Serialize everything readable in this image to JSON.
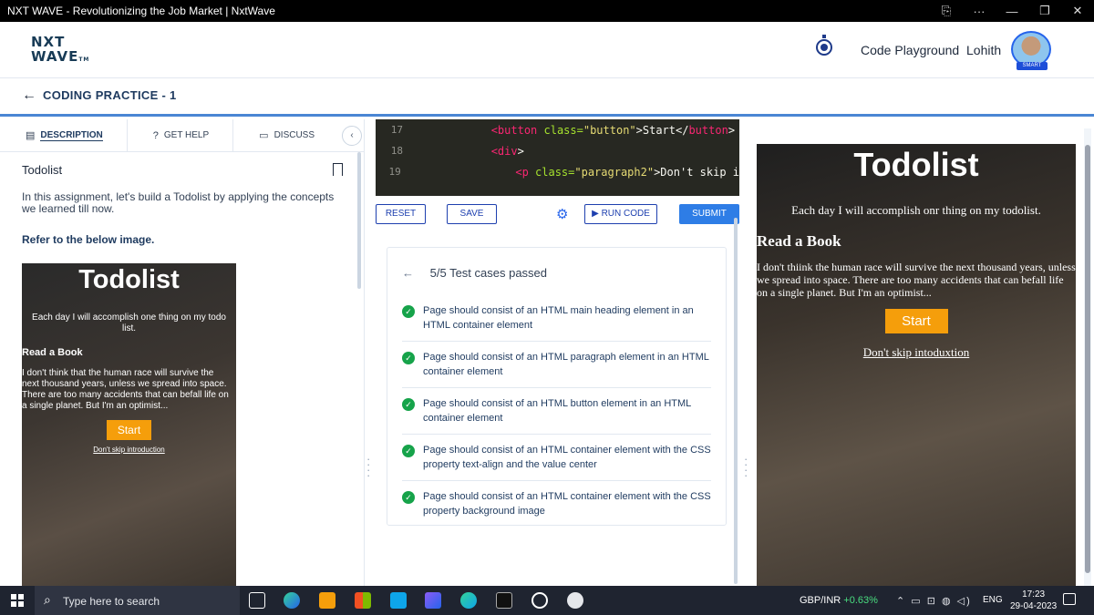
{
  "window": {
    "title": "NXT WAVE - Revolutionizing the Job Market | NxtWave",
    "controls": [
      "⎘",
      "···",
      "—",
      "❐",
      "✕"
    ]
  },
  "header": {
    "logo_line1": "NXT",
    "logo_line2": "WAVE",
    "logo_tm": "TM",
    "playground_label": "Code Playground",
    "user_name": "Lohith",
    "avatar_badge": "SMART"
  },
  "subheader": {
    "back_icon": "←",
    "title": "CODING PRACTICE - 1"
  },
  "left": {
    "tabs": [
      {
        "icon": "▤",
        "label": "DESCRIPTION"
      },
      {
        "icon": "?",
        "label": "GET HELP"
      },
      {
        "icon": "▭",
        "label": "DISCUSS"
      }
    ],
    "collapse_icon": "‹",
    "problem_title": "Todolist",
    "description": "In this assignment, let's build a Todolist by applying the concepts we learned till now.",
    "refer_text": "Refer to the below image.",
    "reference": {
      "heading": "Todolist",
      "tagline": "Each day I will accomplish one thing on my todo list.",
      "subheading": "Read a Book",
      "paragraph": "I don't think that the human race will survive the next thousand years, unless we spread into space. There are too many accidents that can befall life on a single planet. But I'm an optimist...",
      "button": "Start",
      "link": "Don't skip introduction"
    }
  },
  "editor": {
    "lines": [
      {
        "num": "17",
        "indent": "            ",
        "open": "<button",
        "attr": " class=",
        "value": "\"button\"",
        "text": ">Start</",
        "close": "button",
        "end": ">"
      },
      {
        "num": "18",
        "indent": "            ",
        "open": "<div",
        "attr": "",
        "value": "",
        "text": ">",
        "close": "",
        "end": ""
      },
      {
        "num": "19",
        "indent": "                ",
        "open": "<p",
        "attr": " class=",
        "value": "\"paragraph2\"",
        "text": ">Don't skip i",
        "close": "",
        "end": ""
      }
    ]
  },
  "toolbar": {
    "reset": "RESET",
    "save": "SAVE",
    "settings_icon": "⚙",
    "run": "▶ RUN CODE",
    "submit": "SUBMIT"
  },
  "results": {
    "back_icon": "←",
    "summary": "5/5 Test cases passed",
    "check_icon": "✓",
    "cases": [
      "Page should consist of an HTML main heading element in an HTML container element",
      "Page should consist of an HTML paragraph element in an HTML container element",
      "Page should consist of an HTML button element in an HTML container element",
      "Page should consist of an HTML container element with the CSS property text-align and the value center",
      "Page should consist of an HTML container element with the CSS property background image"
    ]
  },
  "output": {
    "heading": "Todolist",
    "tagline": "Each day I will accomplish onr thing on my todolist.",
    "subheading": "Read a Book",
    "paragraph": "I don't thiink the human race will survive the next thousand years, unless we spread into space. There are too many accidents that can befall life on a single planet. But I'm an optimist...",
    "button": "Start",
    "link": "Don't skip intoduxtion"
  },
  "taskbar": {
    "search_icon": "⌕",
    "search_placeholder": "Type here to search",
    "fx_pair": "GBP/INR",
    "fx_change": "+0.63%",
    "tray": "⌃ ▭ ⊡ ◍ ◁)",
    "language": "ENG",
    "time": "17:23",
    "date": "29-04-2023"
  },
  "colors": {
    "accent_blue": "#2e7de6",
    "pass_green": "#16a34a",
    "start_orange": "#f59e0b"
  }
}
